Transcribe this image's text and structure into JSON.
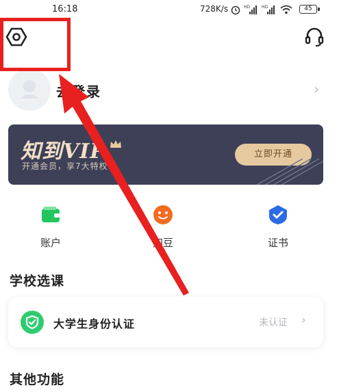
{
  "status_bar": {
    "time": "16:18",
    "network_speed": "728K/s",
    "battery": "45"
  },
  "header": {
    "settings_icon": "settings-hexagon-icon",
    "support_icon": "headset-icon"
  },
  "profile": {
    "login_label": "去登录"
  },
  "vip": {
    "title": "知到VIP",
    "subtitle": "开通会员，享7大特权",
    "button_label": "立即开通"
  },
  "shortcuts": [
    {
      "label": "账户",
      "icon": "wallet-icon",
      "color": "#22c55e"
    },
    {
      "label": "知豆",
      "icon": "zhidou-smile-icon",
      "color": "#f26b21"
    },
    {
      "label": "证书",
      "icon": "certificate-icon",
      "color": "#2c6be6"
    }
  ],
  "school": {
    "title": "学校选课",
    "verify_label": "大学生身份认证",
    "verify_status": "未认证"
  },
  "other": {
    "title": "其他功能"
  },
  "annotation": {
    "color": "#e8201f"
  }
}
